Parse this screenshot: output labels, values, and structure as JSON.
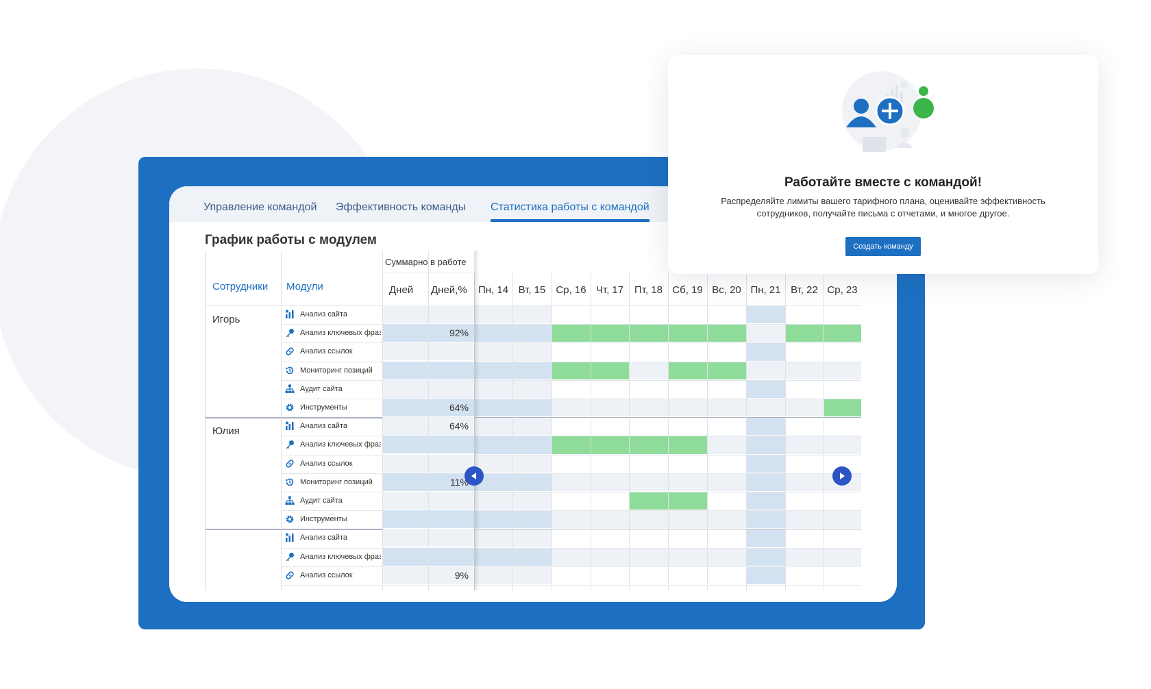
{
  "tabs": [
    {
      "label": "Управление командой",
      "active": false
    },
    {
      "label": "Эффективность команды",
      "active": false
    },
    {
      "label": "Статистика работы с командой",
      "active": true
    }
  ],
  "section_title": "График работы с модулем",
  "table": {
    "col_employees": "Сотрудники",
    "col_modules": "Модули",
    "summary_header": "Суммарно в работе",
    "col_days": "Дней",
    "col_days_pct": "Дней,%",
    "dates": [
      "Пн, 14",
      "Вт, 15",
      "Ср, 16",
      "Чт, 17",
      "Пт, 18",
      "Сб, 19",
      "Вс, 20",
      "Пн, 21",
      "Вт, 22",
      "Ср, 23"
    ],
    "employees": [
      "Игорь",
      "Юлия"
    ],
    "rows": [
      {
        "module": "Анализ сайта",
        "icon": "site-analysis-icon",
        "pct": "",
        "active": []
      },
      {
        "module": "Анализ ключевых фраз",
        "icon": "key-icon",
        "pct": "92%",
        "active": [
          2,
          3,
          4,
          5,
          6,
          8,
          9
        ]
      },
      {
        "module": "Анализ ссылок",
        "icon": "link-icon",
        "pct": "",
        "active": []
      },
      {
        "module": "Мониторинг позиций",
        "icon": "history-icon",
        "pct": "",
        "active": [
          2,
          3,
          5,
          6
        ]
      },
      {
        "module": "Аудит сайта",
        "icon": "sitemap-icon",
        "pct": "",
        "active": []
      },
      {
        "module": "Инструменты",
        "icon": "gear-icon",
        "pct": "64%",
        "active": [
          9
        ]
      },
      {
        "module": "Анализ сайта",
        "icon": "site-analysis-icon",
        "pct": "64%",
        "active": []
      },
      {
        "module": "Анализ ключевых фраз",
        "icon": "key-icon",
        "pct": "",
        "active": [
          2,
          3,
          4,
          5
        ]
      },
      {
        "module": "Анализ ссылок",
        "icon": "link-icon",
        "pct": "",
        "active": []
      },
      {
        "module": "Мониторинг позиций",
        "icon": "history-icon",
        "pct": "11%",
        "active": []
      },
      {
        "module": "Аудит сайта",
        "icon": "sitemap-icon",
        "pct": "",
        "active": [
          4,
          5
        ]
      },
      {
        "module": "Инструменты",
        "icon": "gear-icon",
        "pct": "",
        "active": []
      },
      {
        "module": "Анализ сайта",
        "icon": "site-analysis-icon",
        "pct": "",
        "active": []
      },
      {
        "module": "Анализ ключевых фраз",
        "icon": "key-icon",
        "pct": "",
        "active": []
      },
      {
        "module": "Анализ ссылок",
        "icon": "link-icon",
        "pct": "9%",
        "active": []
      }
    ]
  },
  "popup": {
    "title": "Работайте вместе с командой!",
    "description": "Распределяйте лимиты вашего тарифного плана, оценивайте эффективность сотрудников, получайте письма с отчетами, и многое другое.",
    "button": "Создать команду"
  },
  "colors": {
    "frame": "#1d6fc1",
    "active_cell": "#8fdc9a",
    "shaded_cell": "#d3e2f1",
    "light_cell": "#eef1f5",
    "nav_arrow": "#2d54c4"
  }
}
